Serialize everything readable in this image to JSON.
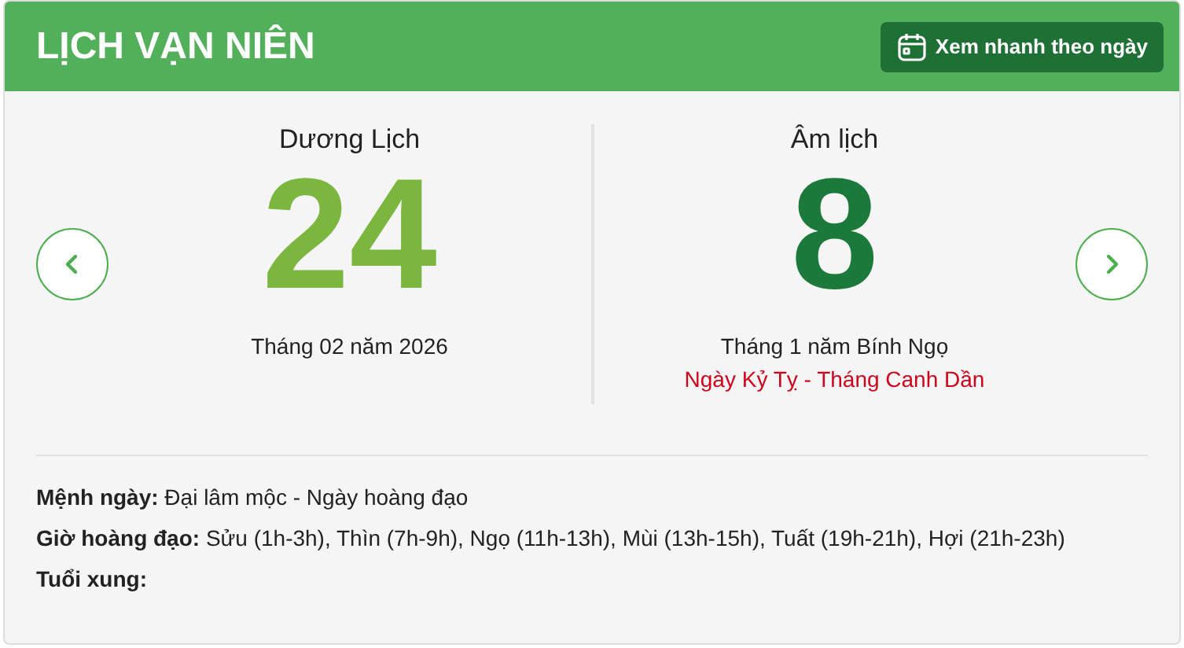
{
  "header": {
    "title": "LỊCH VẠN NIÊN",
    "quick_view_button": "Xem nhanh theo ngày"
  },
  "solar": {
    "heading": "Dương Lịch",
    "day": "24",
    "month_year": "Tháng 02 năm 2026"
  },
  "lunar": {
    "heading": "Âm lịch",
    "day": "8",
    "month_year": "Tháng 1 năm Bính Ngọ",
    "can_chi": "Ngày Kỷ Tỵ - Tháng Canh Dần"
  },
  "details": [
    {
      "text": "**Mệnh ngày:** Đại lâm mộc - Ngày hoàng đạo"
    },
    {
      "text": "**Giờ hoàng đạo:** Sửu (1h-3h), Thìn (7h-9h), Ngọ (11h-13h), Mùi (13h-15h), Tuất (19h-21h), Hợi (21h-23h)"
    },
    {
      "text": "**Tuổi xung:**"
    }
  ]
}
